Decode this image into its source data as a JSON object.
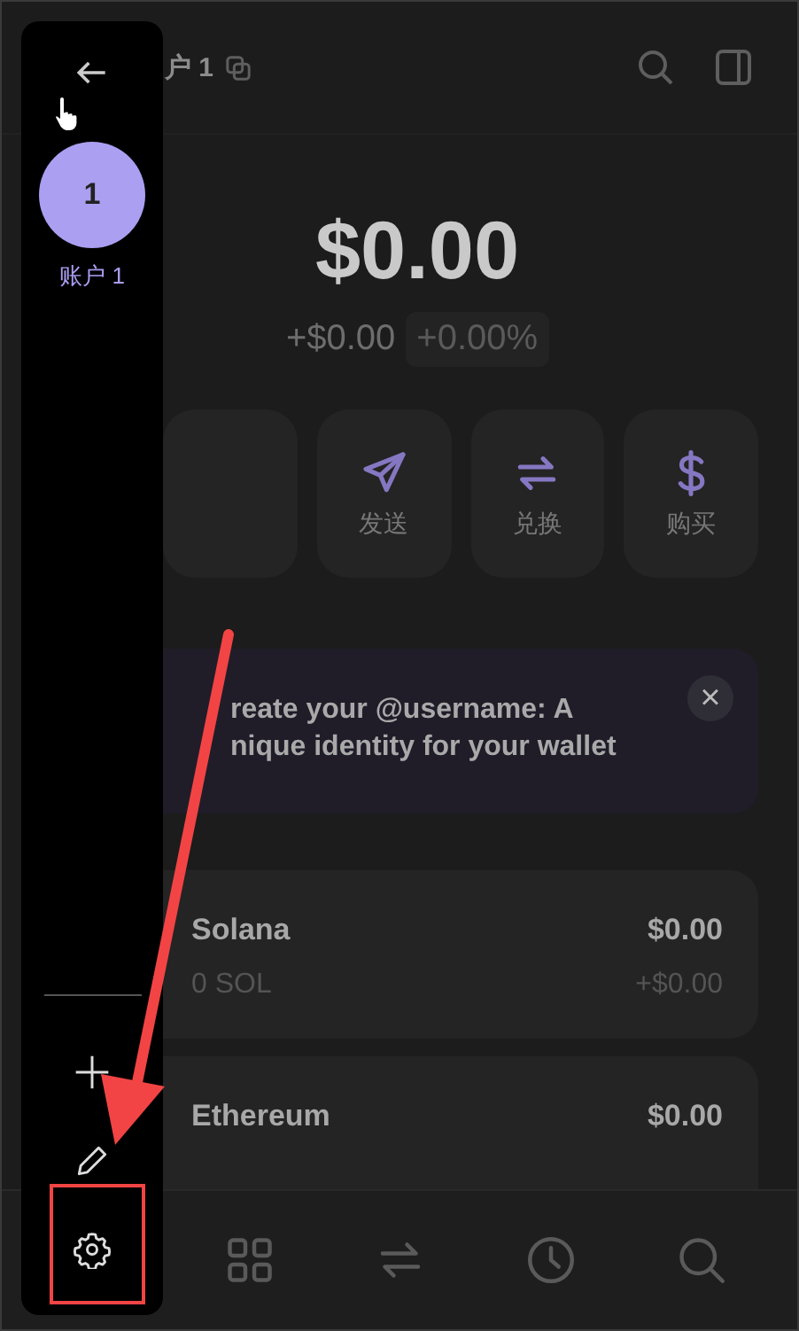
{
  "header": {
    "title": "户 1"
  },
  "balance": {
    "amount": "$0.00",
    "change": "+$0.00",
    "percent": "+0.00%"
  },
  "actions": [
    {
      "label": "发送",
      "kind": "send"
    },
    {
      "label": "兑换",
      "kind": "swap"
    },
    {
      "label": "购买",
      "kind": "buy"
    }
  ],
  "banner": {
    "lines": [
      "reate your @username: A",
      "nique identity for your wallet"
    ],
    "close": "×"
  },
  "tokens": [
    {
      "name": "Solana",
      "amount": "0 SOL",
      "value": "$0.00",
      "change": "+$0.00"
    },
    {
      "name": "Ethereum",
      "value": "$0.00"
    }
  ],
  "nav": [
    {
      "kind": "grid"
    },
    {
      "kind": "swap"
    },
    {
      "kind": "history"
    },
    {
      "kind": "search"
    }
  ],
  "sidebar": {
    "accounts": [
      {
        "initial": "1",
        "name": "账户 1"
      }
    ],
    "tools": [
      {
        "kind": "add"
      },
      {
        "kind": "edit"
      },
      {
        "kind": "settings"
      }
    ]
  }
}
